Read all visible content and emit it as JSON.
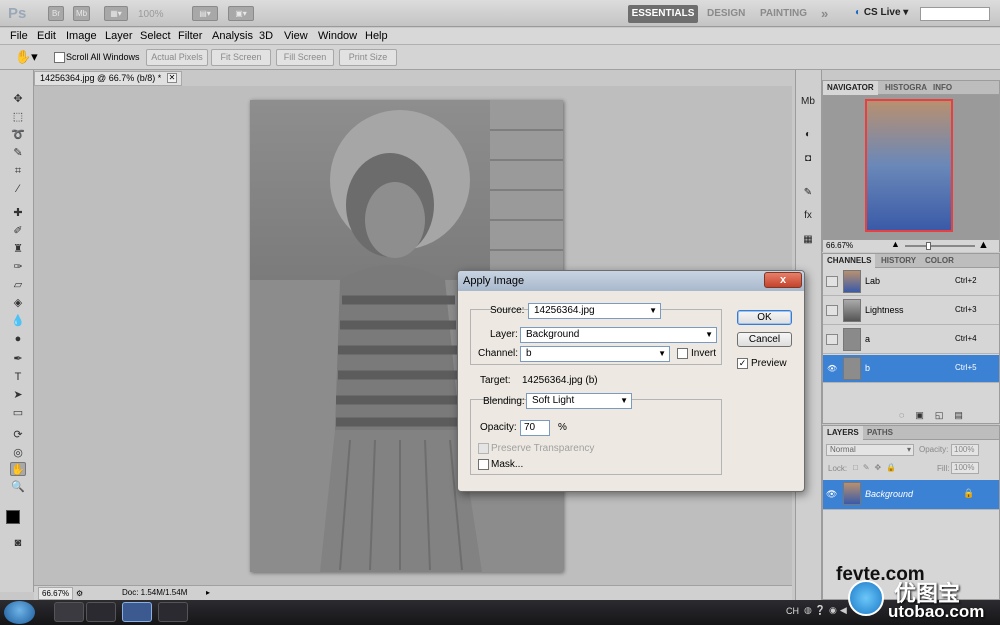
{
  "app": {
    "logo": "Ps",
    "zoom": "100%",
    "workspaces": [
      "ESSENTIALS",
      "DESIGN",
      "PAINTING"
    ],
    "more": "»",
    "cs_live": "CS Live ▾"
  },
  "menu": [
    "File",
    "Edit",
    "Image",
    "Layer",
    "Select",
    "Filter",
    "Analysis",
    "3D",
    "View",
    "Window",
    "Help"
  ],
  "options": {
    "scroll_all": "Scroll All Windows",
    "actual_pixels": "Actual Pixels",
    "fit_screen": "Fit Screen",
    "fill_screen": "Fill Screen",
    "print_size": "Print Size"
  },
  "document": {
    "tab_title": "14256364.jpg @ 66.7% (b/8) *",
    "zoom_status": "66.67%",
    "doc_status": "Doc: 1.54M/1.54M"
  },
  "navigator": {
    "tabs": [
      "NAVIGATOR",
      "HISTOGRA",
      "INFO"
    ],
    "zoom": "66.67%"
  },
  "channels": {
    "tabs": [
      "CHANNELS",
      "HISTORY",
      "COLOR"
    ],
    "rows": [
      {
        "name": "Lab",
        "key": "Ctrl+2"
      },
      {
        "name": "Lightness",
        "key": "Ctrl+3"
      },
      {
        "name": "a",
        "key": "Ctrl+4"
      },
      {
        "name": "b",
        "key": "Ctrl+5"
      }
    ]
  },
  "layers": {
    "tabs": [
      "LAYERS",
      "PATHS"
    ],
    "blend": "Normal",
    "opacity_label": "Opacity:",
    "opacity": "100%",
    "lock_label": "Lock:",
    "fill_label": "Fill:",
    "fill": "100%",
    "layer_name": "Background"
  },
  "dialog": {
    "title": "Apply Image",
    "close": "x",
    "source_label": "Source:",
    "source": "14256364.jpg",
    "layer_label": "Layer:",
    "layer": "Background",
    "channel_label": "Channel:",
    "channel": "b",
    "invert": "Invert",
    "target_label": "Target:",
    "target": "14256364.jpg (b)",
    "blending_label": "Blending:",
    "blending": "Soft Light",
    "opacity_label": "Opacity:",
    "opacity": "70",
    "percent": "%",
    "preserve": "Preserve Transparency",
    "mask": "Mask...",
    "ok": "OK",
    "cancel": "Cancel",
    "preview": "Preview"
  },
  "taskbar": {
    "lang": "CH",
    "watermark_1": "fevte.com",
    "watermark_2": "utobao.com",
    "watermark_site": "优图宝"
  }
}
